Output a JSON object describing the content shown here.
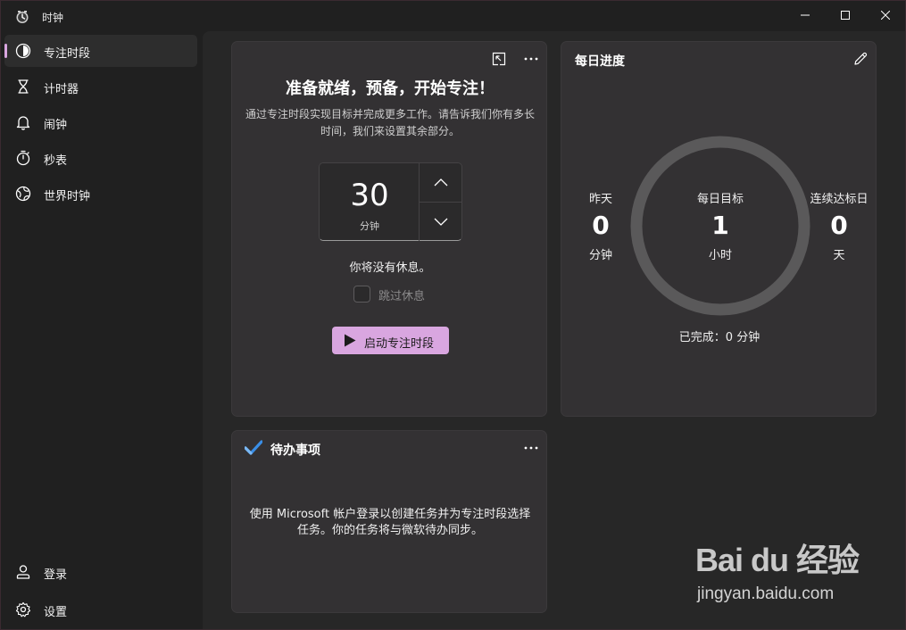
{
  "app": {
    "title": "时钟"
  },
  "sidebar": {
    "items": [
      {
        "label": "专注时段",
        "icon": "focus-icon",
        "active": true
      },
      {
        "label": "计时器",
        "icon": "hourglass-icon"
      },
      {
        "label": "闹钟",
        "icon": "bell-icon"
      },
      {
        "label": "秒表",
        "icon": "stopwatch-icon"
      },
      {
        "label": "世界时钟",
        "icon": "globe-icon"
      }
    ],
    "bottom": [
      {
        "label": "登录",
        "icon": "person-icon"
      },
      {
        "label": "设置",
        "icon": "gear-icon"
      }
    ],
    "accent_color": "#d9a6e0"
  },
  "focus": {
    "heading": "准备就绪，预备，开始专注！",
    "description": "通过专注时段实现目标并完成更多工作。请告诉我们你有多长时间，我们来设置其余部分。",
    "stepper_value": "30",
    "stepper_unit": "分钟",
    "no_break_text": "你将没有休息。",
    "skip_break_label": "跳过休息",
    "skip_break_checked": false,
    "start_button_label": "启动专注时段"
  },
  "progress": {
    "title": "每日进度",
    "yesterday_label": "昨天",
    "yesterday_value": "0",
    "yesterday_unit": "分钟",
    "goal_label": "每日目标",
    "goal_value": "1",
    "goal_unit": "小时",
    "streak_label": "连续达标日",
    "streak_value": "0",
    "streak_unit": "天",
    "completed_text": "已完成：0 分钟",
    "completed_fraction": 0
  },
  "todo": {
    "title": "待办事项",
    "message": "使用 Microsoft 帐户登录以创建任务并为专注时段选择任务。你的任务将与微软待办同步。"
  },
  "watermark": {
    "brand": "Bai du 经验",
    "url": "jingyan.baidu.com"
  }
}
